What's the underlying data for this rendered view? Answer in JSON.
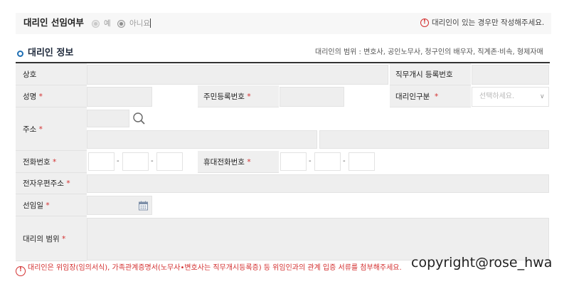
{
  "top_bar": {
    "title": "대리인 선임여부",
    "options": [
      {
        "label": "예",
        "selected": false
      },
      {
        "label": "아니요",
        "selected": true
      }
    ],
    "notice": "대리인이 있는 경우만 작성해주세요."
  },
  "section": {
    "title": "대리인 정보",
    "note": "대리인의 범위 : 변호사, 공인노무사, 청구인의 배우자, 직계존·비속, 형제자매"
  },
  "fields": {
    "company": {
      "label": "상호",
      "required": false
    },
    "business_reg_no": {
      "label": "직무개시 등록번호",
      "required": false
    },
    "name": {
      "label": "성명",
      "required": true
    },
    "resident_no": {
      "label": "주민등록번호",
      "required": true
    },
    "agent_type": {
      "label": "대리인구분",
      "required": true,
      "placeholder": "선택하세요."
    },
    "address": {
      "label": "주소",
      "required": true
    },
    "phone": {
      "label": "전화번호",
      "required": true,
      "separator": "-"
    },
    "mobile": {
      "label": "휴대전화번호",
      "required": true,
      "separator": "-"
    },
    "email": {
      "label": "전자우편주소",
      "required": true
    },
    "appointment_date": {
      "label": "선임일",
      "required": true
    },
    "scope": {
      "label": "대리의 범위",
      "required": true
    }
  },
  "required_mark": "*",
  "footer_notice": "대리인은 위임장(임의서식), 가족관계증명서(노무사•변호사는 직무개시등록증) 등 위임인과의 관계 입증 서류를 첨부해주세요.",
  "watermark": "copyright@rose_hwa",
  "icons": {
    "alert": "exclamation-circle",
    "search": "magnifier",
    "calendar": "calendar",
    "select": "chevron-down"
  },
  "colors": {
    "accent": "#1f6fb4",
    "required": "#d32f2f",
    "label_bg": "#efefef",
    "disabled_input": "#eeeeee"
  }
}
